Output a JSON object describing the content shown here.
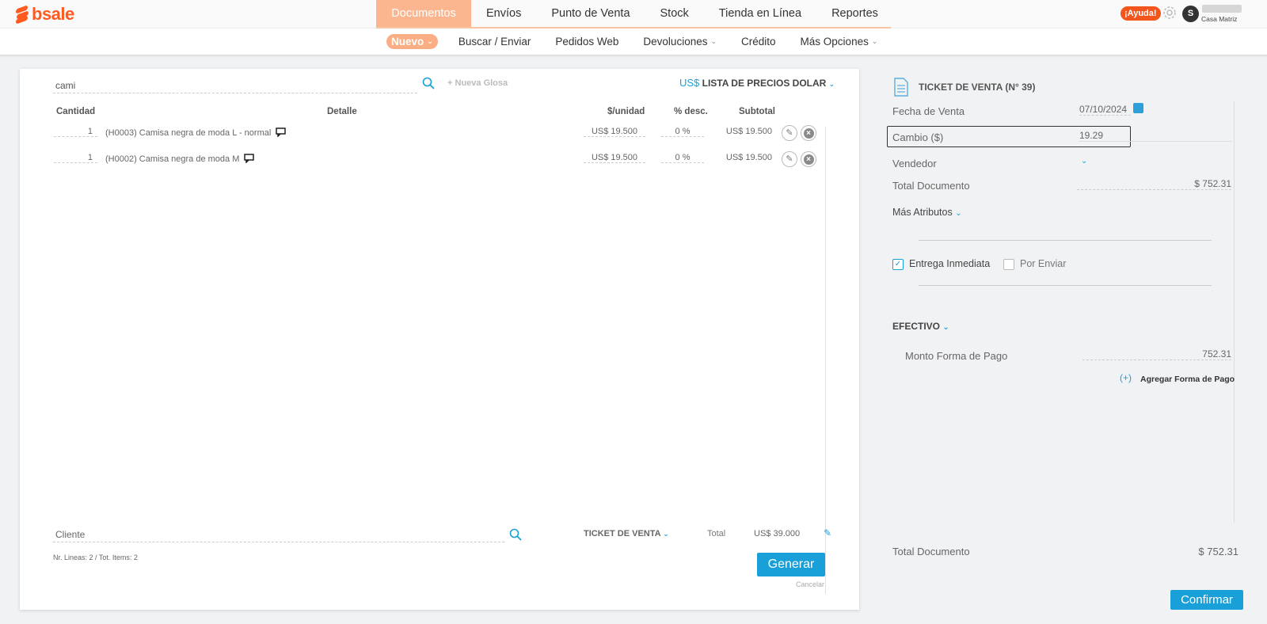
{
  "brand": {
    "name": "bsale",
    "color": "#ff5a1f"
  },
  "topnav": {
    "items": [
      "Documentos",
      "Envíos",
      "Punto de Venta",
      "Stock",
      "Tienda en Línea",
      "Reportes"
    ],
    "active": "Documentos",
    "help_label": "¡Ayuda!",
    "avatar_initial": "S",
    "branch": "Casa Matriz"
  },
  "subnav": {
    "items": [
      {
        "label": "Nuevo",
        "dropdown": true,
        "active": true
      },
      {
        "label": "Buscar / Enviar",
        "dropdown": false
      },
      {
        "label": "Pedidos Web",
        "dropdown": false
      },
      {
        "label": "Devoluciones",
        "dropdown": true
      },
      {
        "label": "Crédito",
        "dropdown": false
      },
      {
        "label": "Más Opciones",
        "dropdown": true
      }
    ]
  },
  "editor": {
    "search_value": "cami",
    "new_gloss_label": "Nueva Glosa",
    "currency_symbol": "US$",
    "price_list": "LISTA DE PRECIOS DOLAR",
    "columns": {
      "qty": "Cantidad",
      "detail": "Detalle",
      "unit_price": "$/unidad",
      "discount": "% desc.",
      "subtotal": "Subtotal"
    },
    "rows": [
      {
        "qty": "1",
        "detail": "(H0003) Camisa negra de moda L - normal",
        "unit_price": "US$ 19.500",
        "discount": "0 %",
        "subtotal": "US$ 19.500"
      },
      {
        "qty": "1",
        "detail": "(H0002) Camisa negra de moda M",
        "unit_price": "US$ 19.500",
        "discount": "0 %",
        "subtotal": "US$ 19.500"
      }
    ],
    "client_placeholder": "Cliente",
    "doc_type": "TICKET DE VENTA",
    "total_label": "Total",
    "total_value": "US$ 39.000",
    "counts": "Nr. Lineas: 2 / Tot. Items: 2",
    "generate_label": "Generar",
    "cancel_label": "Cancelar"
  },
  "panel": {
    "title": "TICKET DE VENTA (N° 39)",
    "sale_date_label": "Fecha de Venta",
    "sale_date": "07/10/2024",
    "exchange_label": "Cambio ($)",
    "exchange_value": "19.29",
    "seller_label": "Vendedor",
    "total_doc_label": "Total Documento",
    "total_doc_value": "$ 752.31",
    "more_attrs_label": "Más Atributos",
    "delivery_now_label": "Entrega Inmediata",
    "delivery_now_checked": true,
    "to_send_label": "Por Enviar",
    "to_send_checked": false,
    "payment_method": "EFECTIVO",
    "payment_amount_label": "Monto Forma de Pago",
    "payment_amount": "752.31",
    "add_payment_label": "Agregar Forma de Pago",
    "footer_total_label": "Total Documento",
    "footer_total_value": "$ 752.31",
    "confirm_label": "Confirmar"
  }
}
